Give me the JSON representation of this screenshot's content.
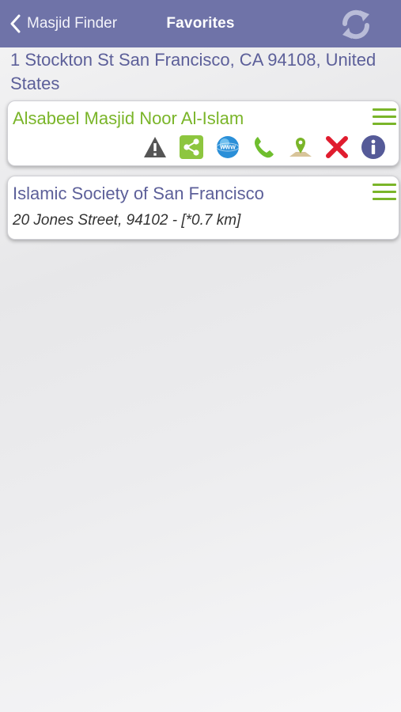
{
  "navbar": {
    "back_label": "Masjid Finder",
    "title": "Favorites",
    "back_icon": "chevron-left-icon",
    "refresh_icon": "refresh-icon"
  },
  "location": {
    "address": "1 Stockton St San Francisco, CA 94108, United States"
  },
  "favorites": [
    {
      "name": "Alsabeel Masjid Noor Al-Islam",
      "expanded": true,
      "actions": [
        "warning-icon",
        "share-icon",
        "website-icon",
        "phone-icon",
        "map-pin-icon",
        "delete-icon",
        "info-icon"
      ]
    },
    {
      "name": "Islamic Society of San Francisco",
      "address": "20 Jones Street, 94102 - [*0.7 km]",
      "expanded": false
    }
  ],
  "colors": {
    "navbar": "#6f73a8",
    "accent_green": "#7ab529",
    "text_purple": "#5c5f99",
    "delete_red": "#e01c2e"
  }
}
